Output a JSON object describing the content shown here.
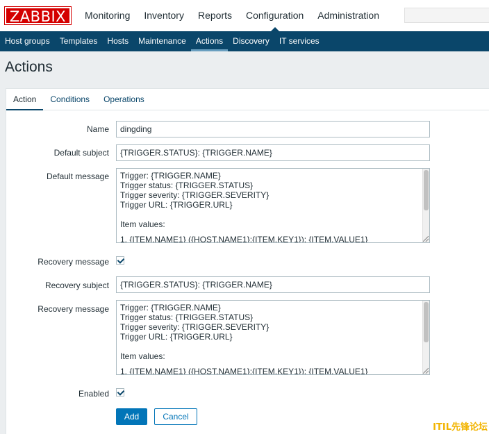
{
  "header": {
    "logo": "ZABBIX",
    "nav": [
      "Monitoring",
      "Inventory",
      "Reports",
      "Configuration",
      "Administration"
    ],
    "active_nav": "Configuration"
  },
  "subnav": {
    "items": [
      "Host groups",
      "Templates",
      "Hosts",
      "Maintenance",
      "Actions",
      "Discovery",
      "IT services"
    ],
    "active": "Actions"
  },
  "page": {
    "title": "Actions"
  },
  "tabs": [
    "Action",
    "Conditions",
    "Operations"
  ],
  "form": {
    "name_label": "Name",
    "name_value": "dingding",
    "default_subject_label": "Default subject",
    "default_subject_value": "{TRIGGER.STATUS}: {TRIGGER.NAME}",
    "default_message_label": "Default message",
    "default_message_lines": [
      "Trigger: {TRIGGER.NAME}",
      "Trigger status: {TRIGGER.STATUS}",
      "Trigger severity: {TRIGGER.SEVERITY}",
      "Trigger URL: {TRIGGER.URL}",
      "",
      "Item values:",
      "",
      "1. {ITEM.NAME1} ({HOST.NAME1}:{ITEM.KEY1}): {ITEM.VALUE1}"
    ],
    "recovery_checkbox_label": "Recovery message",
    "recovery_checked": true,
    "recovery_subject_label": "Recovery subject",
    "recovery_subject_value": "{TRIGGER.STATUS}: {TRIGGER.NAME}",
    "recovery_message_label": "Recovery message",
    "recovery_message_lines": [
      "Trigger: {TRIGGER.NAME}",
      "Trigger status: {TRIGGER.STATUS}",
      "Trigger severity: {TRIGGER.SEVERITY}",
      "Trigger URL: {TRIGGER.URL}",
      "",
      "Item values:",
      "",
      "1. {ITEM.NAME1} ({HOST.NAME1}:{ITEM.KEY1}): {ITEM.VALUE1}"
    ],
    "enabled_label": "Enabled",
    "enabled_checked": true,
    "add_label": "Add",
    "cancel_label": "Cancel"
  },
  "watermark": "ITIL先锋论坛"
}
